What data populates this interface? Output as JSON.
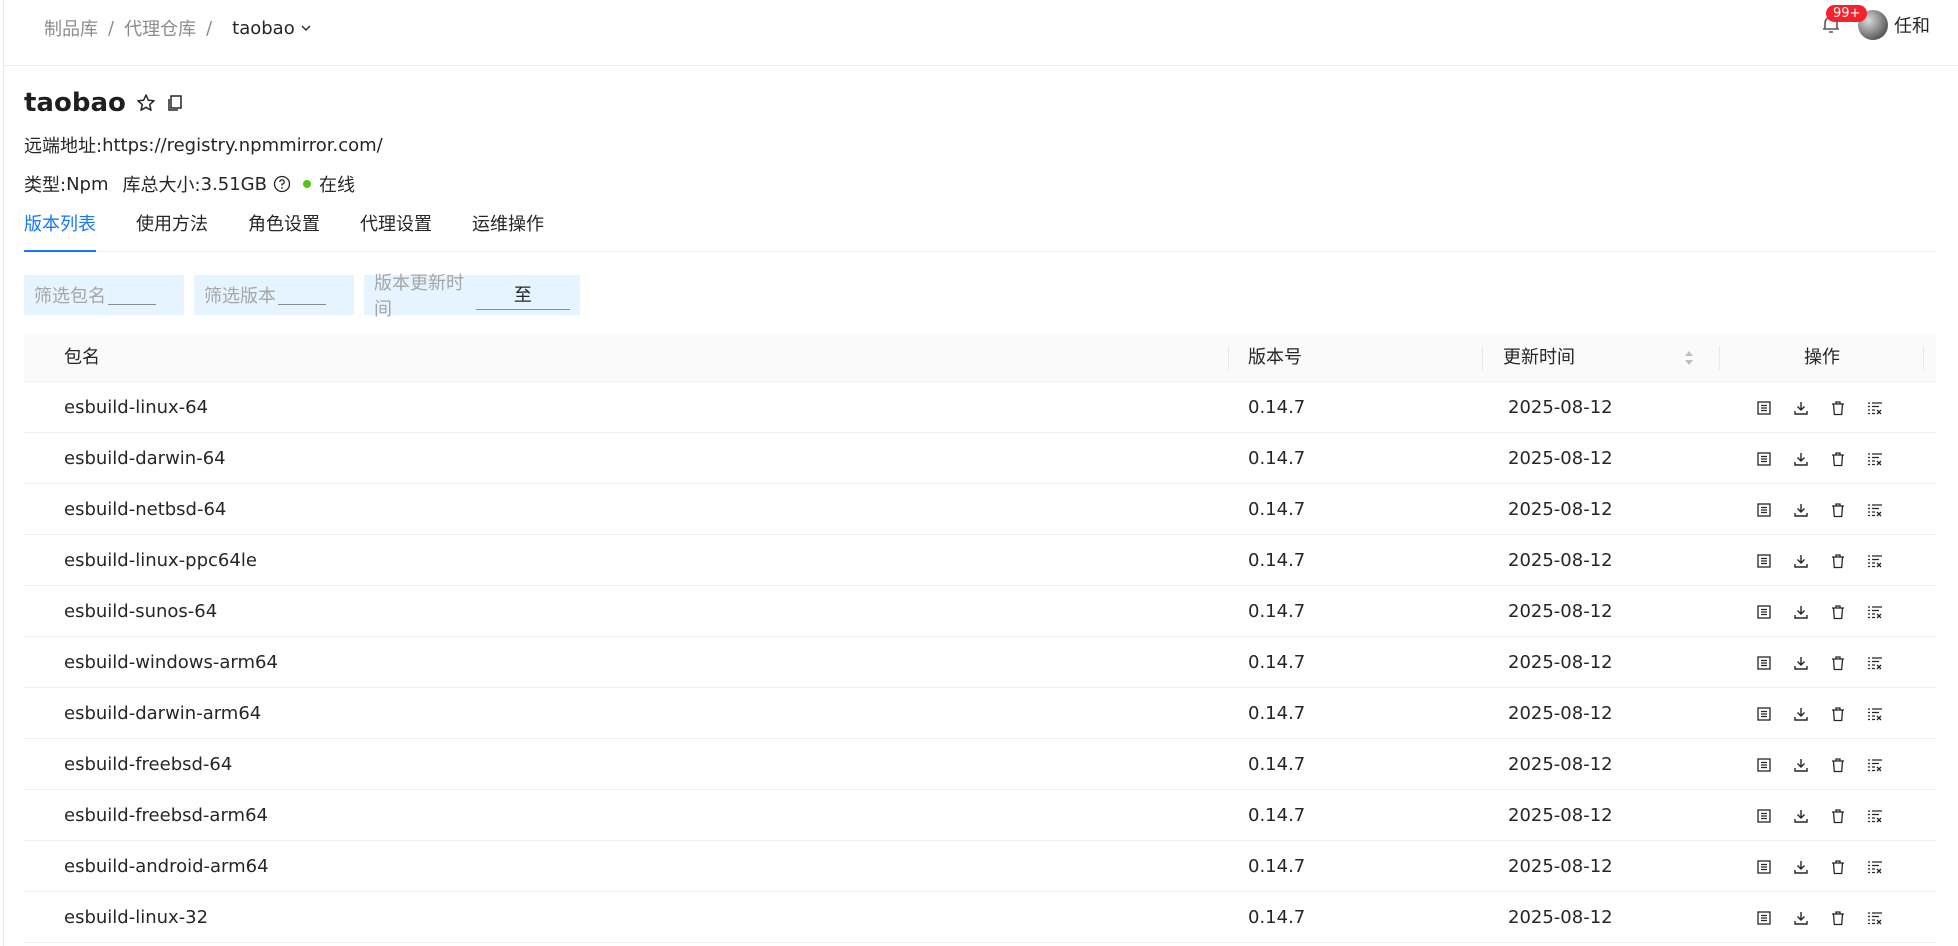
{
  "breadcrumb": {
    "items": [
      "制品库",
      "代理仓库"
    ],
    "separator": "/",
    "current": "taobao"
  },
  "header": {
    "notification_badge": "99+",
    "user_name": "任和"
  },
  "repo": {
    "name": "taobao",
    "remote_label": "远端地址:",
    "remote_url": "https://registry.npmmirror.com/",
    "type_label": "类型:",
    "type_value": "Npm",
    "size_label": "库总大小:",
    "size_value": "3.51GB",
    "status": "在线",
    "status_color": "#52c41a"
  },
  "tabs": [
    {
      "label": "版本列表",
      "active": true
    },
    {
      "label": "使用方法",
      "active": false
    },
    {
      "label": "角色设置",
      "active": false
    },
    {
      "label": "代理设置",
      "active": false
    },
    {
      "label": "运维操作",
      "active": false
    }
  ],
  "filters": {
    "package_placeholder": "筛选包名",
    "version_placeholder": "筛选版本",
    "time_placeholder": "版本更新时间",
    "time_to": "至"
  },
  "table": {
    "headers": {
      "name": "包名",
      "version": "版本号",
      "updated": "更新时间",
      "actions": "操作"
    },
    "rows": [
      {
        "name": "esbuild-linux-64",
        "version": "0.14.7",
        "updated": "2025-08-12"
      },
      {
        "name": "esbuild-darwin-64",
        "version": "0.14.7",
        "updated": "2025-08-12"
      },
      {
        "name": "esbuild-netbsd-64",
        "version": "0.14.7",
        "updated": "2025-08-12"
      },
      {
        "name": "esbuild-linux-ppc64le",
        "version": "0.14.7",
        "updated": "2025-08-12"
      },
      {
        "name": "esbuild-sunos-64",
        "version": "0.14.7",
        "updated": "2025-08-12"
      },
      {
        "name": "esbuild-windows-arm64",
        "version": "0.14.7",
        "updated": "2025-08-12"
      },
      {
        "name": "esbuild-darwin-arm64",
        "version": "0.14.7",
        "updated": "2025-08-12"
      },
      {
        "name": "esbuild-freebsd-64",
        "version": "0.14.7",
        "updated": "2025-08-12"
      },
      {
        "name": "esbuild-freebsd-arm64",
        "version": "0.14.7",
        "updated": "2025-08-12"
      },
      {
        "name": "esbuild-android-arm64",
        "version": "0.14.7",
        "updated": "2025-08-12"
      },
      {
        "name": "esbuild-linux-32",
        "version": "0.14.7",
        "updated": "2025-08-12"
      }
    ]
  },
  "colors": {
    "accent": "#1677ff",
    "filter_bg": "#e6f4ff",
    "badge": "#f5222d"
  },
  "icons": {
    "row_actions": [
      "detail-icon",
      "download-icon",
      "delete-icon",
      "clean-list-icon"
    ]
  }
}
